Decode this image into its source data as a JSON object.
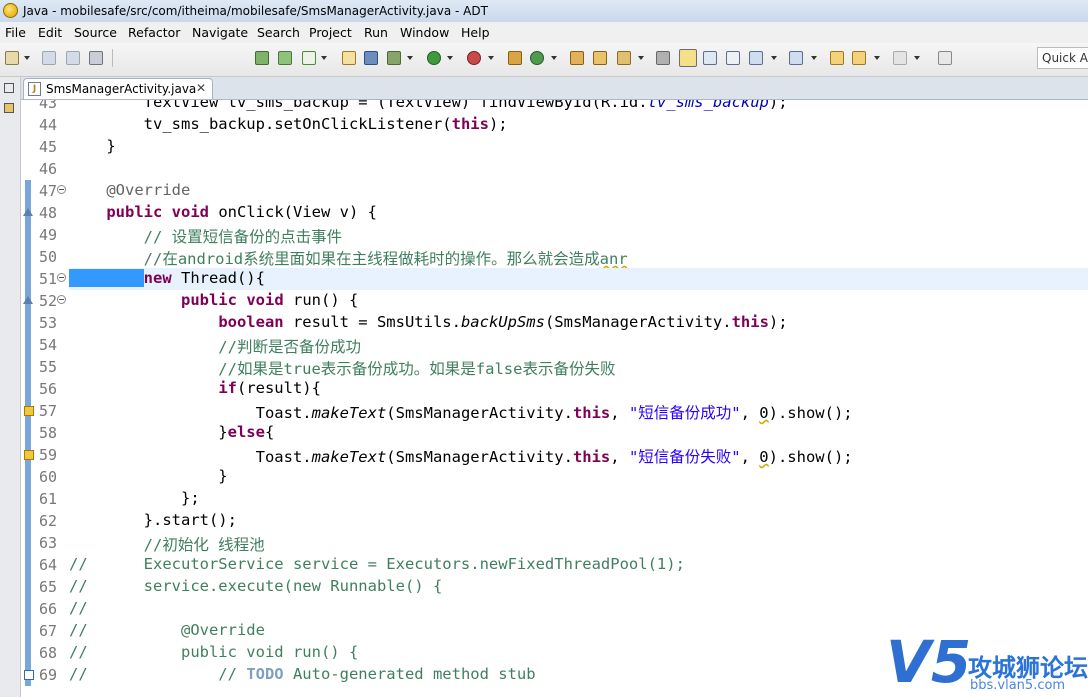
{
  "window": {
    "title": "Java - mobilesafe/src/com/itheima/mobilesafe/SmsManagerActivity.java - ADT"
  },
  "menu": [
    "File",
    "Edit",
    "Source",
    "Refactor",
    "Navigate",
    "Search",
    "Project",
    "Run",
    "Window",
    "Help"
  ],
  "quick_access": {
    "label": "Quick Ac"
  },
  "editor": {
    "tab": {
      "label": "SmsManagerActivity.java",
      "close": "✕"
    },
    "lines": [
      {
        "n": "43",
        "code": "        TextView tv_sms_backup = (TextView) findViewById(R.id.tv_sms_backup);"
      },
      {
        "n": "44",
        "code": "        tv_sms_backup.setOnClickListener(this);"
      },
      {
        "n": "45",
        "code": "    }"
      },
      {
        "n": "46",
        "code": ""
      },
      {
        "n": "47",
        "code": "    @Override"
      },
      {
        "n": "48",
        "code": "    public void onClick(View v) {"
      },
      {
        "n": "49",
        "code": "        // 设置短信备份的点击事件"
      },
      {
        "n": "50",
        "code": "        //在android系统里面如果在主线程做耗时的操作。那么就会造成anr"
      },
      {
        "n": "51",
        "code": "        new Thread(){"
      },
      {
        "n": "52",
        "code": "            public void run() {"
      },
      {
        "n": "53",
        "code": "                boolean result = SmsUtils.backUpSms(SmsManagerActivity.this);"
      },
      {
        "n": "54",
        "code": "                //判断是否备份成功"
      },
      {
        "n": "55",
        "code": "                //如果是true表示备份成功。如果是false表示备份失败"
      },
      {
        "n": "56",
        "code": "                if(result){"
      },
      {
        "n": "57",
        "code": "                    Toast.makeText(SmsManagerActivity.this, \"短信备份成功\", 0).show();"
      },
      {
        "n": "58",
        "code": "                }else{"
      },
      {
        "n": "59",
        "code": "                    Toast.makeText(SmsManagerActivity.this, \"短信备份失败\", 0).show();"
      },
      {
        "n": "60",
        "code": "                }"
      },
      {
        "n": "61",
        "code": "            };"
      },
      {
        "n": "62",
        "code": "        }.start();"
      },
      {
        "n": "63",
        "code": "        //初始化 线程池"
      },
      {
        "n": "64",
        "code": "//      ExecutorService service = Executors.newFixedThreadPool(1);"
      },
      {
        "n": "65",
        "code": "//      service.execute(new Runnable() {"
      },
      {
        "n": "66",
        "code": "//"
      },
      {
        "n": "67",
        "code": "//          @Override"
      },
      {
        "n": "68",
        "code": "//          public void run() {"
      },
      {
        "n": "69",
        "code": "//              // TODO Auto-generated method stub"
      }
    ]
  },
  "watermark": {
    "logo": "V5",
    "name": "攻城狮论坛",
    "url": "bbs.vlan5.com"
  }
}
